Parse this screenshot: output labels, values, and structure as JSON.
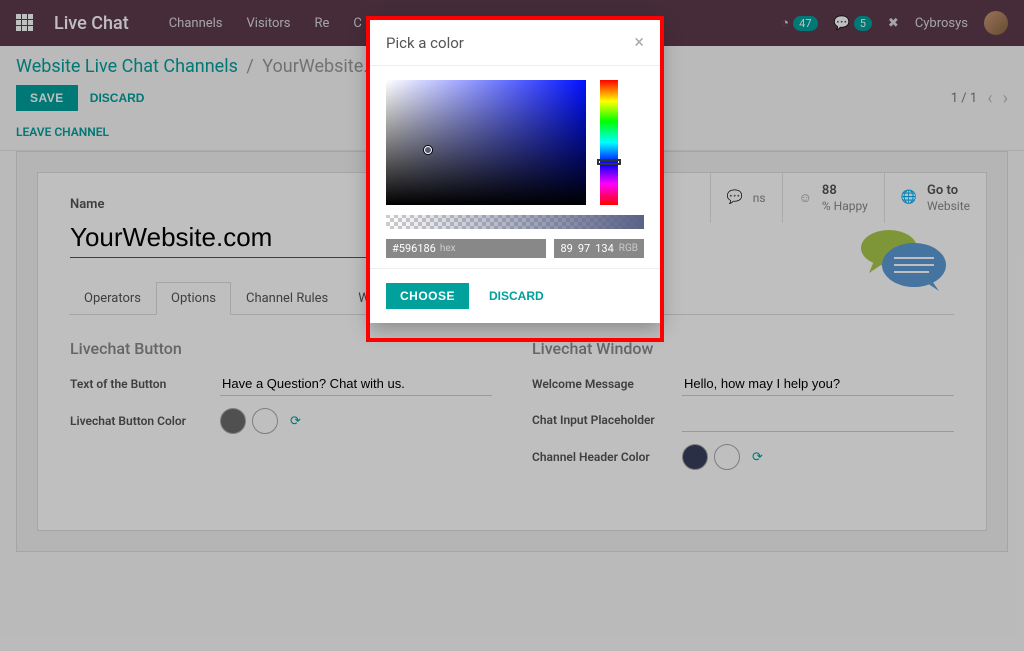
{
  "nav": {
    "brand": "Live Chat",
    "items": [
      "Channels",
      "Visitors",
      "Re",
      "C"
    ],
    "badge1": "47",
    "badge2": "5",
    "username": "Cybrosys"
  },
  "breadcrumb": {
    "root": "Website Live Chat Channels",
    "current": "YourWebsite."
  },
  "actions": {
    "save": "SAVE",
    "discard": "DISCARD",
    "leave": "LEAVE CHANNEL"
  },
  "pager": {
    "text": "1 / 1"
  },
  "stats": {
    "sessions_val": "",
    "sessions_lbl": "ns",
    "happy_val": "88",
    "happy_lbl": "% Happy",
    "goto_val": "Go to",
    "goto_lbl": "Website"
  },
  "form": {
    "name_label": "Name",
    "name_value": "YourWebsite.com",
    "tabs": [
      "Operators",
      "Options",
      "Channel Rules",
      "Widget"
    ],
    "active_tab": 1,
    "section_button": "Livechat Button",
    "section_window": "Livechat Window",
    "button_text_label": "Text of the Button",
    "button_text_value": "Have a Question? Chat with us.",
    "button_color_label": "Livechat Button Color",
    "welcome_label": "Welcome Message",
    "welcome_value": "Hello, how may I help you?",
    "placeholder_label": "Chat Input Placeholder",
    "placeholder_value": "",
    "header_color_label": "Channel Header Color",
    "colors": {
      "button1": "#6b6b6b",
      "button2": "#ffffff",
      "header1": "#3a3f5c",
      "header2": "#ffffff"
    }
  },
  "modal": {
    "title": "Pick a color",
    "hex": "#596186",
    "r": "89",
    "g": "97",
    "b": "134",
    "hex_tag": "hex",
    "rgb_tag": "RGB",
    "choose": "CHOOSE",
    "discard": "DISCARD"
  }
}
